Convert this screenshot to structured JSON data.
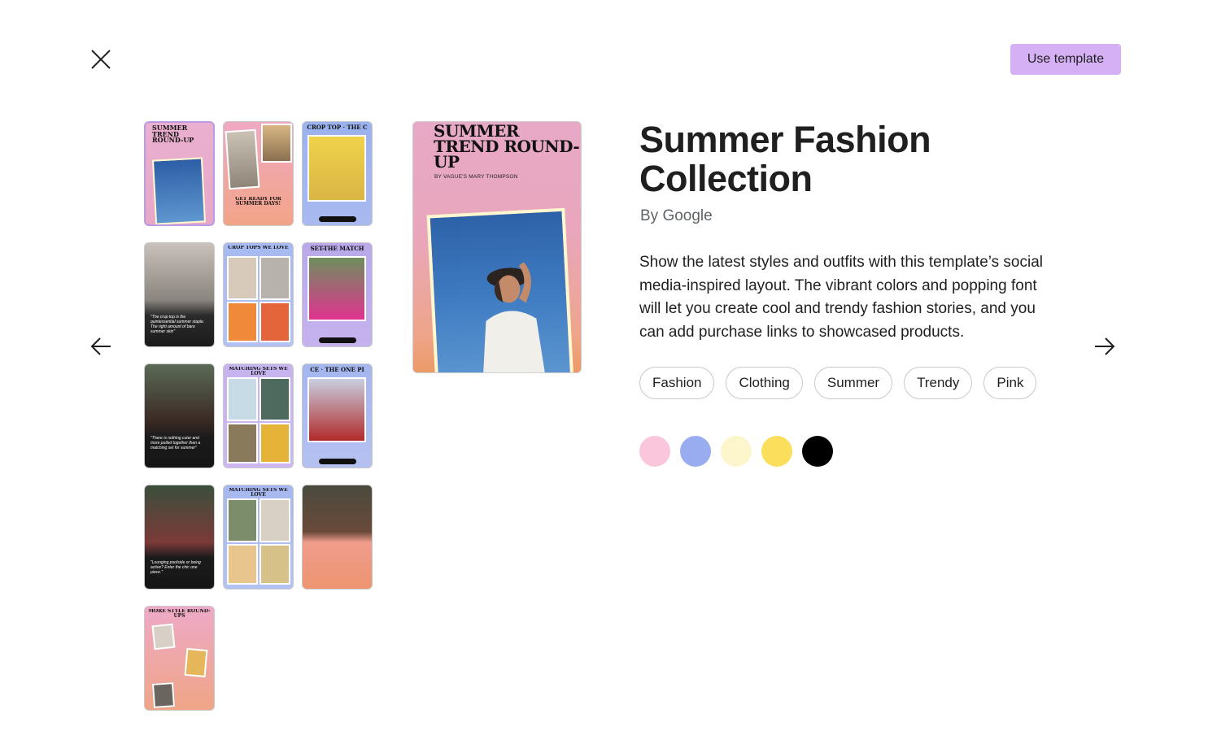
{
  "header": {
    "close_icon": "close-icon",
    "use_template_label": "Use template"
  },
  "navigation": {
    "prev_icon": "arrow-left-icon",
    "next_icon": "arrow-right-icon"
  },
  "thumbnails": [
    {
      "heading": "SUMMER TREND ROUND-UP",
      "caption": "BY VAGUE'S MARY THOMPSON",
      "selected": true
    },
    {
      "heading": "GET READY FOR SUMMER DAYS!",
      "caption": ""
    },
    {
      "heading": "CROP TOP · THE C",
      "caption": ""
    },
    {
      "heading": "",
      "caption": "\"The crop top is the quintessential summer staple. The right amount of bare summer skin\""
    },
    {
      "heading": "CROP TOPS WE LOVE",
      "caption": ""
    },
    {
      "heading": "SET-THE MATCH",
      "caption": ""
    },
    {
      "heading": "",
      "caption": "\"There is nothing cuter and more pulled together than a matching set for summer\""
    },
    {
      "heading": "MATCHING SETS WE LOVE",
      "caption": ""
    },
    {
      "heading": "CE · THE ONE PI",
      "caption": ""
    },
    {
      "heading": "",
      "caption": "\"Lounging poolside or being active? Enter the chic one piece.\""
    },
    {
      "heading": "MATCHING SETS WE LOVE",
      "caption": ""
    },
    {
      "heading": "",
      "caption": ""
    },
    {
      "heading": "MORE STYLE ROUND-UPS",
      "caption": ""
    }
  ],
  "preview": {
    "title": "SUMMER TREND ROUND-UP",
    "byline": "BY VAGUE'S MARY THOMPSON"
  },
  "details": {
    "title": "Summer Fashion Collection",
    "author": "By Google",
    "description": "Show the latest styles and outfits with this template’s social media-inspired layout. The vibrant colors and popping font will let you create cool and trendy fashion stories, and you can add purchase links to showcased products.",
    "tags": [
      "Fashion",
      "Clothing",
      "Summer",
      "Trendy",
      "Pink"
    ],
    "colors": [
      "#f9c6db",
      "#9aacf0",
      "#fdf6cd",
      "#fbdf5c",
      "#000000"
    ]
  }
}
